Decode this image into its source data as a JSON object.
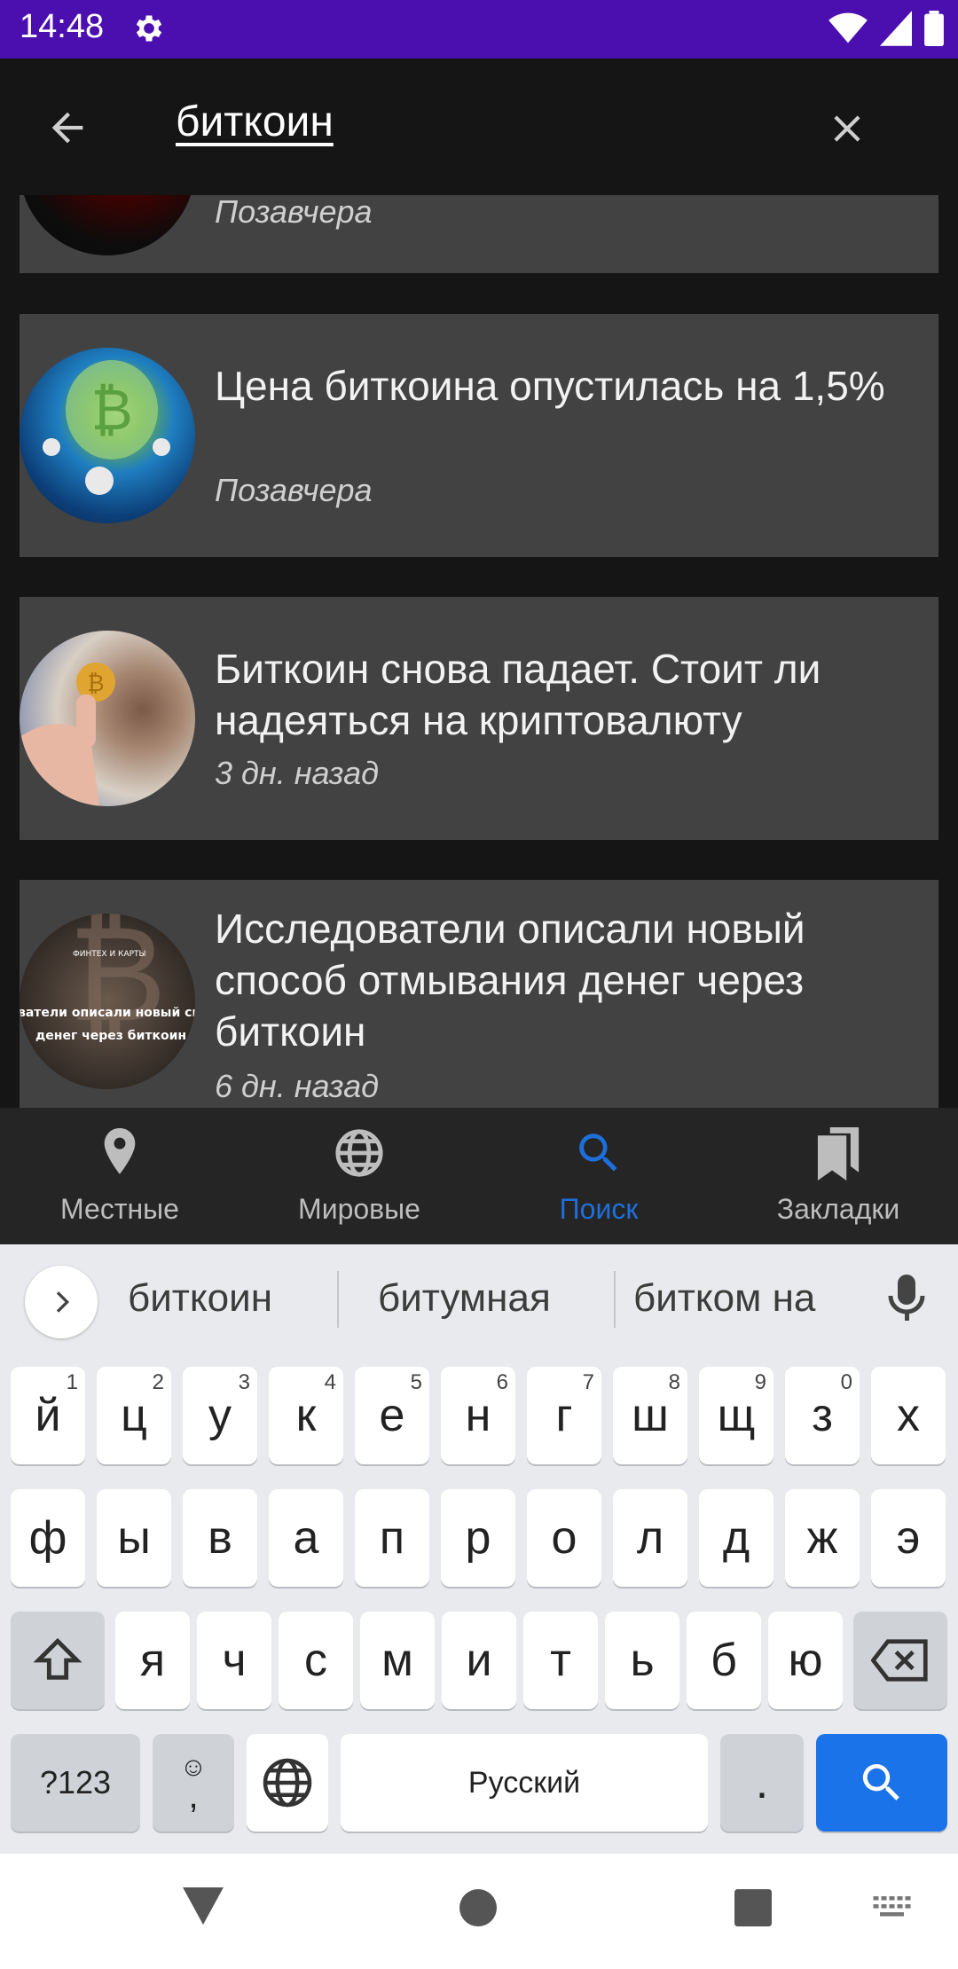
{
  "status_bar": {
    "time": "14:48"
  },
  "header": {
    "query": "биткоин"
  },
  "articles": [
    {
      "title": "",
      "date": "Позавчера"
    },
    {
      "title": "Цена биткоина опустилась на 1,5%",
      "date": "Позавчера"
    },
    {
      "title": "Биткоин снова падает. Стоит ли надеяться на криптовалюту",
      "date": "3 дн. назад"
    },
    {
      "title": "Исследователи описали новый способ отмывания денег через биткоин",
      "date": "6 дн. назад",
      "thumb_text": [
        "ФИНТЕХ И КАРТЫ",
        "ватели описали новый спосо",
        "денег через биткоин"
      ]
    }
  ],
  "bottom_nav": [
    {
      "label": "Местные",
      "icon": "location-pin-icon",
      "active": false
    },
    {
      "label": "Мировые",
      "icon": "globe-icon",
      "active": false
    },
    {
      "label": "Поиск",
      "icon": "search-icon",
      "active": true
    },
    {
      "label": "Закладки",
      "icon": "bookmarks-icon",
      "active": false
    }
  ],
  "keyboard": {
    "suggestions": [
      "биткоин",
      "битумная",
      "битком на"
    ],
    "row1": [
      {
        "key": "й",
        "hint": "1"
      },
      {
        "key": "ц",
        "hint": "2"
      },
      {
        "key": "у",
        "hint": "3"
      },
      {
        "key": "к",
        "hint": "4"
      },
      {
        "key": "е",
        "hint": "5"
      },
      {
        "key": "н",
        "hint": "6"
      },
      {
        "key": "г",
        "hint": "7"
      },
      {
        "key": "ш",
        "hint": "8"
      },
      {
        "key": "щ",
        "hint": "9"
      },
      {
        "key": "з",
        "hint": "0"
      },
      {
        "key": "х",
        "hint": ""
      }
    ],
    "row2": [
      "ф",
      "ы",
      "в",
      "а",
      "п",
      "р",
      "о",
      "л",
      "д",
      "ж",
      "э"
    ],
    "row3": [
      "я",
      "ч",
      "с",
      "м",
      "и",
      "т",
      "ь",
      "б",
      "ю"
    ],
    "symbols_label": "?123",
    "emoji_label": ",",
    "space_label": "Русский",
    "period_label": "."
  },
  "colors": {
    "status_bar": "#4b0fb0",
    "card_bg": "#424242",
    "active_nav": "#1e6fd9",
    "search_key": "#1a73e8"
  }
}
